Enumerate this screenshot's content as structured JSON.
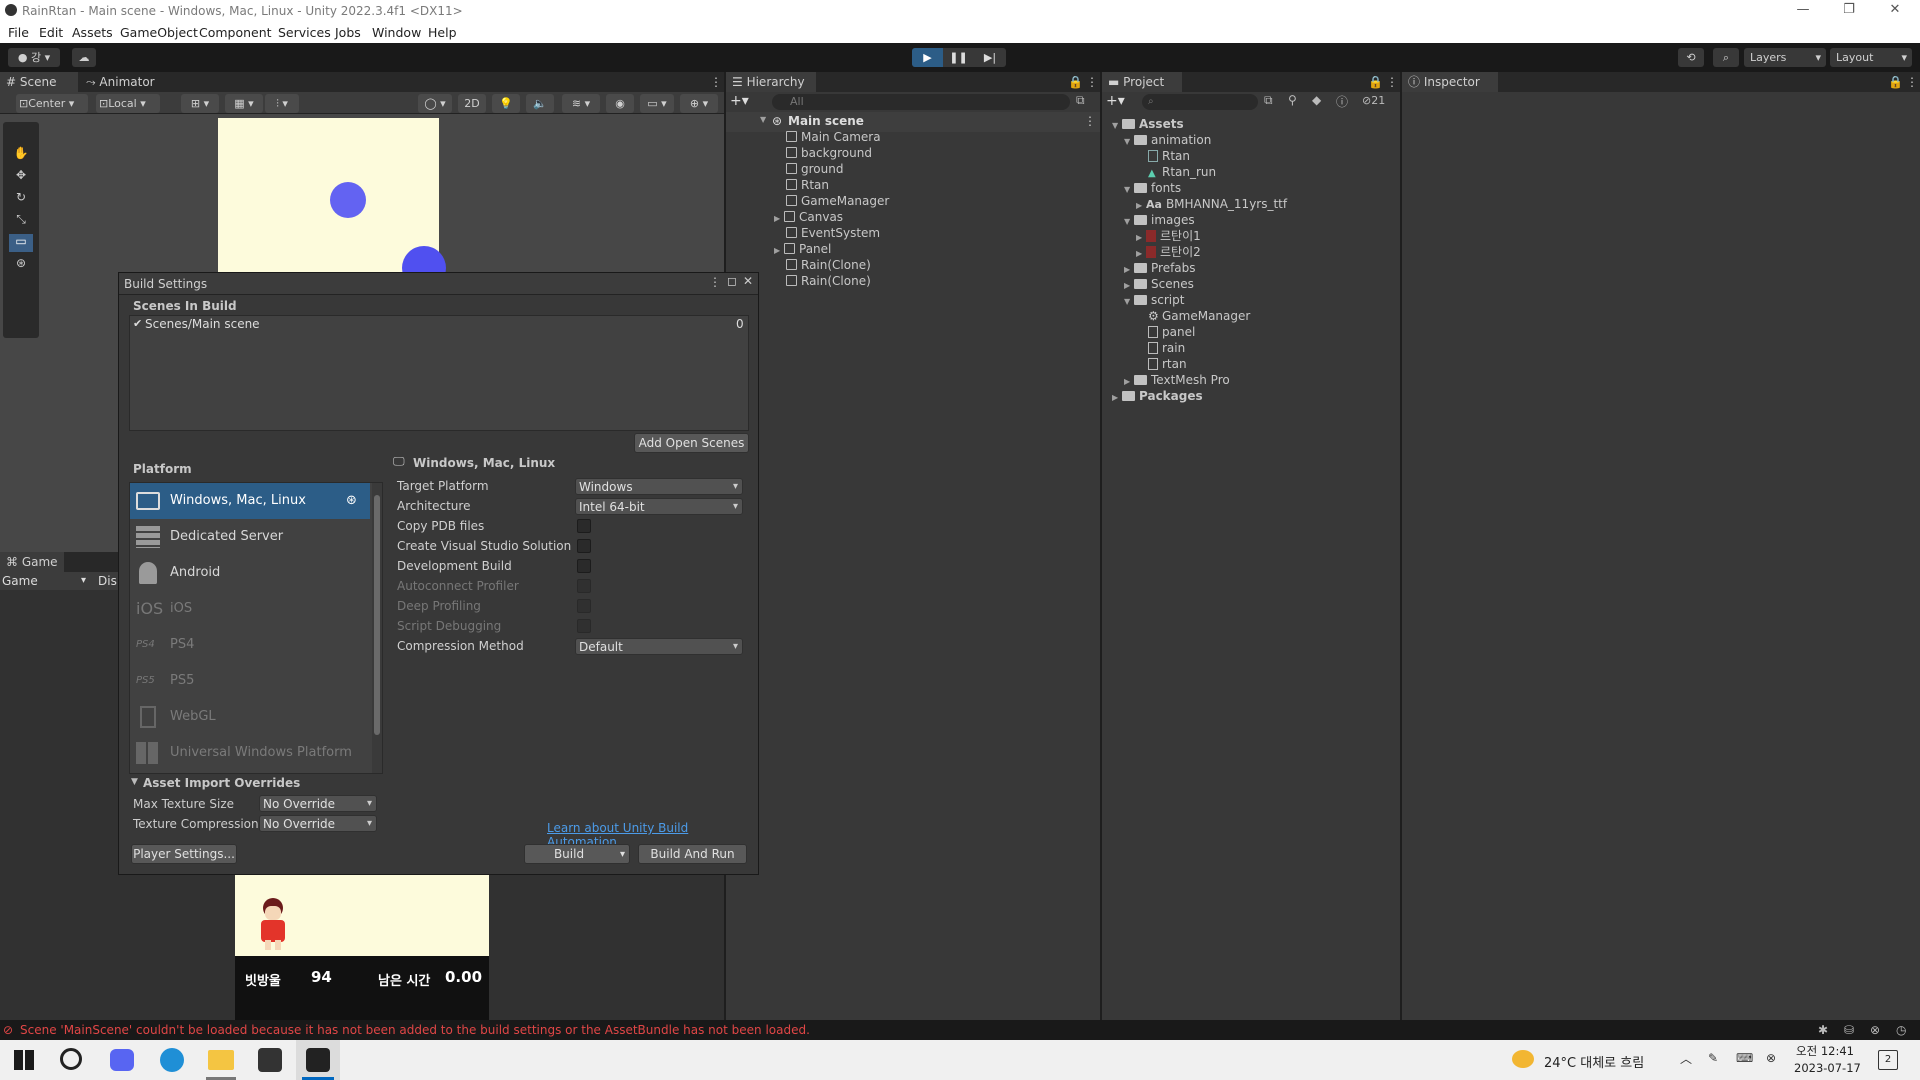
{
  "window": {
    "title": "RainRtan - Main scene - Windows, Mac, Linux - Unity 2022.3.4f1 <DX11>"
  },
  "menu": [
    "File",
    "Edit",
    "Assets",
    "GameObject",
    "Component",
    "Services",
    "Jobs",
    "Window",
    "Help"
  ],
  "toolbar": {
    "account": "강",
    "layers": "Layers",
    "layout": "Layout"
  },
  "scene_panel": {
    "tabs": [
      "Scene",
      "Animator"
    ],
    "pivot": "Center",
    "space": "Local",
    "mode2d": "2D"
  },
  "game_panel": {
    "tab": "Game",
    "display": "Game",
    "display2": "Dis",
    "hud": {
      "label1": "빗방울",
      "value1": "94",
      "label2": "남은 시간",
      "value2": "0.00"
    }
  },
  "hierarchy": {
    "tab": "Hierarchy",
    "search_placeholder": "All",
    "scene": "Main scene",
    "items": [
      "Main Camera",
      "background",
      "ground",
      "Rtan",
      "GameManager",
      "Canvas",
      "EventSystem",
      "Panel",
      "Rain(Clone)",
      "Rain(Clone)"
    ]
  },
  "project": {
    "tab": "Project",
    "count": "21",
    "tree": [
      {
        "label": "Assets",
        "bold": true
      },
      {
        "label": "animation"
      },
      {
        "label": "Rtan"
      },
      {
        "label": "Rtan_run"
      },
      {
        "label": "fonts"
      },
      {
        "label": "BMHANNA_11yrs_ttf",
        "prefix": "Aa"
      },
      {
        "label": "images"
      },
      {
        "label": "르탄이1"
      },
      {
        "label": "르탄이2"
      },
      {
        "label": "Prefabs"
      },
      {
        "label": "Scenes"
      },
      {
        "label": "script"
      },
      {
        "label": "GameManager"
      },
      {
        "label": "panel"
      },
      {
        "label": "rain"
      },
      {
        "label": "rtan"
      },
      {
        "label": "TextMesh Pro"
      },
      {
        "label": "Packages",
        "bold": true
      }
    ]
  },
  "inspector": {
    "tab": "Inspector"
  },
  "build_settings": {
    "title": "Build Settings",
    "scenes_in_build": "Scenes In Build",
    "scene_entry": "Scenes/Main scene",
    "scene_index": "0",
    "add_open_scenes": "Add Open Scenes",
    "platform_title": "Platform",
    "platforms": [
      "Windows, Mac, Linux",
      "Dedicated Server",
      "Android",
      "iOS",
      "PS4",
      "PS5",
      "WebGL",
      "Universal Windows Platform"
    ],
    "selected_platform_heading": "Windows, Mac, Linux",
    "options": {
      "target_platform_label": "Target Platform",
      "target_platform_value": "Windows",
      "architecture_label": "Architecture",
      "architecture_value": "Intel 64-bit",
      "copy_pdb": "Copy PDB files",
      "create_vs": "Create Visual Studio Solution",
      "dev_build": "Development Build",
      "autoconnect": "Autoconnect Profiler",
      "deep_profiling": "Deep Profiling",
      "script_debugging": "Script Debugging",
      "compression_label": "Compression Method",
      "compression_value": "Default"
    },
    "asset_import_overrides": "Asset Import Overrides",
    "max_texture_label": "Max Texture Size",
    "max_texture_value": "No Override",
    "texture_comp_label": "Texture Compression",
    "texture_comp_value": "No Override",
    "learn_link": "Learn about Unity Build Automation",
    "player_settings": "Player Settings...",
    "build": "Build",
    "build_and_run": "Build And Run"
  },
  "status_message": "Scene 'MainScene' couldn't be loaded because it has not been added to the build settings or the AssetBundle has not been loaded.",
  "taskbar": {
    "weather": "24°C 대체로 흐림",
    "time": "오전 12:41",
    "date": "2023-07-17",
    "notif": "2"
  },
  "colors": {
    "accent": "#2c5d87",
    "circle": "#6363f2",
    "scene_bg": "#fdfbdc",
    "error": "#e04646"
  }
}
